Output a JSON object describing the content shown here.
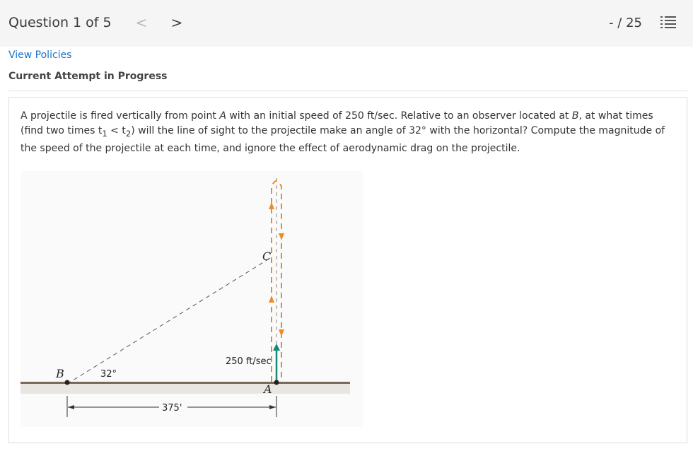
{
  "header": {
    "question_label": "Question 1 of 5",
    "prev_glyph": "<",
    "next_glyph": ">",
    "score": "- / 25",
    "menu_icon": "list-icon"
  },
  "links": {
    "view_policies": "View Policies"
  },
  "status": {
    "attempt": "Current Attempt in Progress"
  },
  "question": {
    "part1": "A projectile is fired vertically from point ",
    "point_a": "A",
    "part2": " with an initial speed of 250 ft/sec. Relative to an observer located at ",
    "point_b": "B",
    "part3": ", at what times (find two times t",
    "sub1": "1",
    "part4": " < t",
    "sub2": "2",
    "part5": ") will the line of sight to the projectile make an angle of 32° with the horizontal? Compute the magnitude of the speed of the projectile at each time, and ignore the effect of aerodynamic drag on the projectile."
  },
  "figure": {
    "label_b": "B",
    "label_a": "A",
    "label_c": "C",
    "angle": "32°",
    "speed": "250 ft/sec",
    "distance": "375'",
    "colors": {
      "path": "#f08a24",
      "velocity": "#138a7a",
      "ground": "#7a6a5a"
    }
  }
}
